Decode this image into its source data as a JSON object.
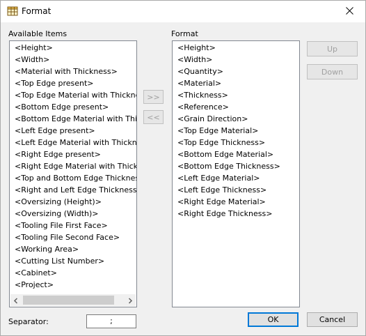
{
  "window": {
    "title": "Format",
    "close_glyph": "✕",
    "app_icon": "table-icon"
  },
  "available": {
    "label": "Available Items",
    "items": [
      "<Height>",
      "<Width>",
      "<Material with Thickness>",
      "<Top Edge present>",
      "<Top Edge Material with Thickness>",
      "<Bottom Edge present>",
      "<Bottom Edge Material with Thickness>",
      "<Left Edge present>",
      "<Left Edge Material with Thickness>",
      "<Right Edge present>",
      "<Right Edge Material with Thickness>",
      "<Top and Bottom Edge Thickness>",
      "<Right and Left Edge Thickness>",
      "<Oversizing (Height)>",
      "<Oversizing (Width)>",
      "<Tooling File First Face>",
      "<Tooling File Second Face>",
      "<Working Area>",
      "<Cutting List Number>",
      "<Cabinet>",
      "<Project>"
    ],
    "scroll_left_glyph": "❮",
    "scroll_right_glyph": "❯"
  },
  "format": {
    "label": "Format",
    "items": [
      "<Height>",
      "<Width>",
      "<Quantity>",
      "<Material>",
      "<Thickness>",
      "<Reference>",
      "<Grain Direction>",
      "<Top Edge Material>",
      "<Top Edge Thickness>",
      "<Bottom Edge Material>",
      "<Bottom Edge Thickness>",
      "<Left Edge Material>",
      "<Left Edge Thickness>",
      "<Right Edge Material>",
      "<Right Edge Thickness>"
    ]
  },
  "buttons": {
    "add": ">>",
    "remove": "<<",
    "up": "Up",
    "down": "Down",
    "ok": "OK",
    "cancel": "Cancel"
  },
  "separator": {
    "label": "Separator:",
    "value": ";"
  },
  "colors": {
    "accent": "#0078d7",
    "disabled_text": "#a0a0a0"
  }
}
